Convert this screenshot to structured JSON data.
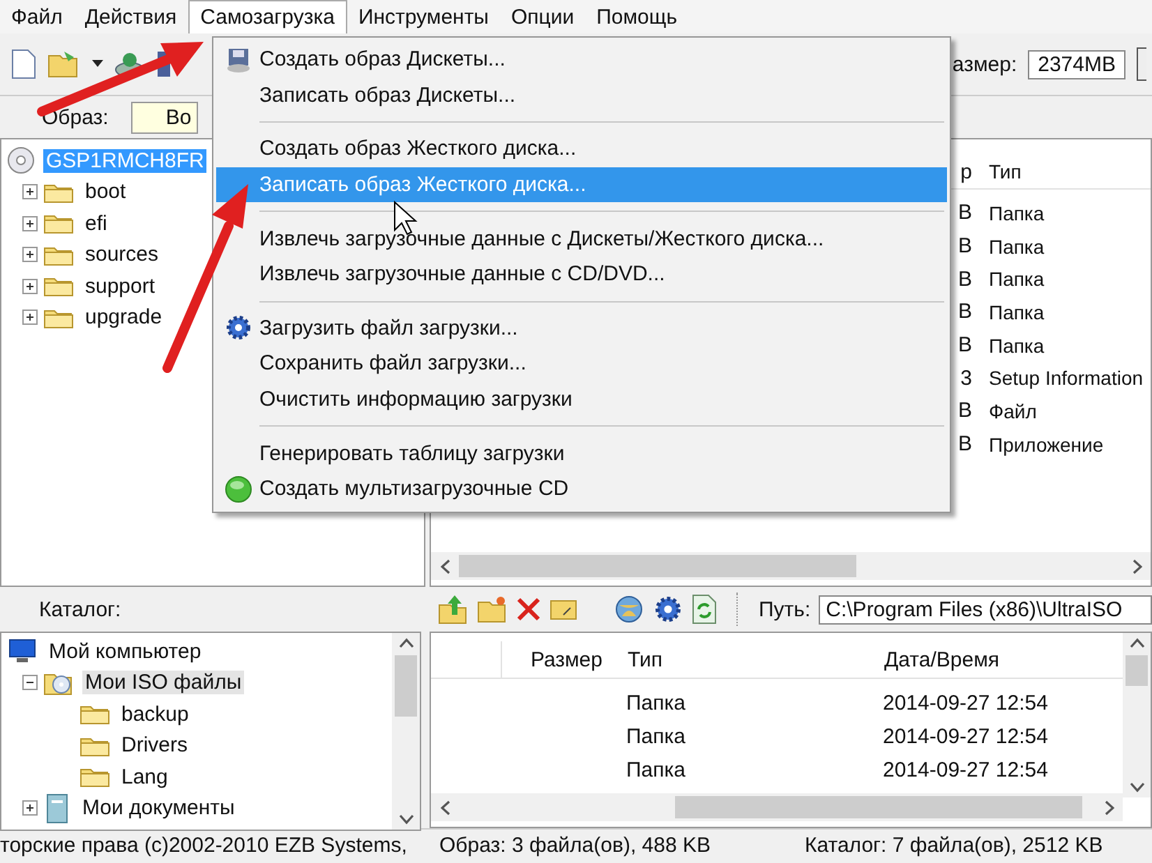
{
  "menu_bar": [
    {
      "label": "Файл",
      "selected": false
    },
    {
      "label": "Действия",
      "selected": false
    },
    {
      "label": "Самозагрузка",
      "selected": true
    },
    {
      "label": "Инструменты",
      "selected": false
    },
    {
      "label": "Опции",
      "selected": false
    },
    {
      "label": "Помощь",
      "selected": false
    }
  ],
  "toolbar": {
    "size_label": "азмер:",
    "size_value": "2374MB"
  },
  "image_field": {
    "label": "Образ:",
    "value": "Во"
  },
  "image_tree": [
    {
      "label": "GSP1RMCH8FR",
      "kind": "disc",
      "selected": true,
      "children": [
        {
          "label": "boot",
          "kind": "folder",
          "selected": false,
          "expanded": false
        },
        {
          "label": "efi",
          "kind": "folder",
          "selected": false,
          "expanded": false
        },
        {
          "label": "sources",
          "kind": "folder",
          "selected": false,
          "expanded": false
        },
        {
          "label": "support",
          "kind": "folder",
          "selected": false,
          "expanded": false
        },
        {
          "label": "upgrade",
          "kind": "folder",
          "selected": false,
          "expanded": false
        }
      ]
    }
  ],
  "image_files": {
    "columns": [
      "р",
      "Тип"
    ],
    "rows": [
      {
        "size": "B",
        "type": "Папка"
      },
      {
        "size": "B",
        "type": "Папка"
      },
      {
        "size": "B",
        "type": "Папка"
      },
      {
        "size": "B",
        "type": "Папка"
      },
      {
        "size": "B",
        "type": "Папка"
      },
      {
        "size": "3",
        "type": "Setup Information"
      },
      {
        "size": "B",
        "type": "Файл"
      },
      {
        "size": "B",
        "type": "Приложение"
      }
    ]
  },
  "catalog_label": "Каталог:",
  "path": {
    "label": "Путь:",
    "value": "C:\\Program Files (x86)\\UltraISO"
  },
  "local_tree": [
    {
      "label": "Мой компьютер",
      "kind": "computer",
      "selected": false,
      "children": [
        {
          "label": "Мои ISO файлы",
          "kind": "iso",
          "selected": true,
          "expanded": true,
          "children": [
            {
              "label": "backup",
              "kind": "folder",
              "selected": false
            },
            {
              "label": "Drivers",
              "kind": "folder",
              "selected": false
            },
            {
              "label": "Lang",
              "kind": "folder",
              "selected": false
            }
          ]
        },
        {
          "label": "Мои документы",
          "kind": "documents",
          "selected": false,
          "expanded": false
        }
      ]
    }
  ],
  "local_files": {
    "columns": [
      "Размер",
      "Тип",
      "Дата/Время"
    ],
    "rows": [
      {
        "type": "Папка",
        "date": "2014-09-27 12:54"
      },
      {
        "type": "Папка",
        "date": "2014-09-27 12:54"
      },
      {
        "type": "Папка",
        "date": "2014-09-27 12:54"
      }
    ]
  },
  "status_bar": [
    "торские права (c)2002-2010 EZB Systems,",
    "Образ: 3 файла(ов), 488 KB",
    "Каталог: 7 файла(ов), 2512 KB"
  ],
  "boot_menu": {
    "groups": [
      [
        {
          "label": "Создать образ Дискеты...",
          "selected": false
        },
        {
          "label": "Записать образ Дискеты...",
          "selected": false
        }
      ],
      [
        {
          "label": "Создать образ Жесткого диска...",
          "selected": false
        },
        {
          "label": "Записать образ Жесткого диска...",
          "selected": true
        }
      ],
      [
        {
          "label": "Извлечь загрузочные данные с Дискеты/Жесткого диска...",
          "selected": false
        },
        {
          "label": "Извлечь загрузочные данные с CD/DVD...",
          "selected": false
        }
      ],
      [
        {
          "label": "Загрузить файл загрузки...",
          "selected": false
        },
        {
          "label": "Сохранить файл загрузки...",
          "selected": false
        },
        {
          "label": "Очистить информацию загрузки",
          "selected": false
        }
      ],
      [
        {
          "label": "Генерировать таблицу загрузки",
          "selected": false
        },
        {
          "label": "Создать мультизагрузочные CD",
          "selected": false
        }
      ]
    ]
  }
}
